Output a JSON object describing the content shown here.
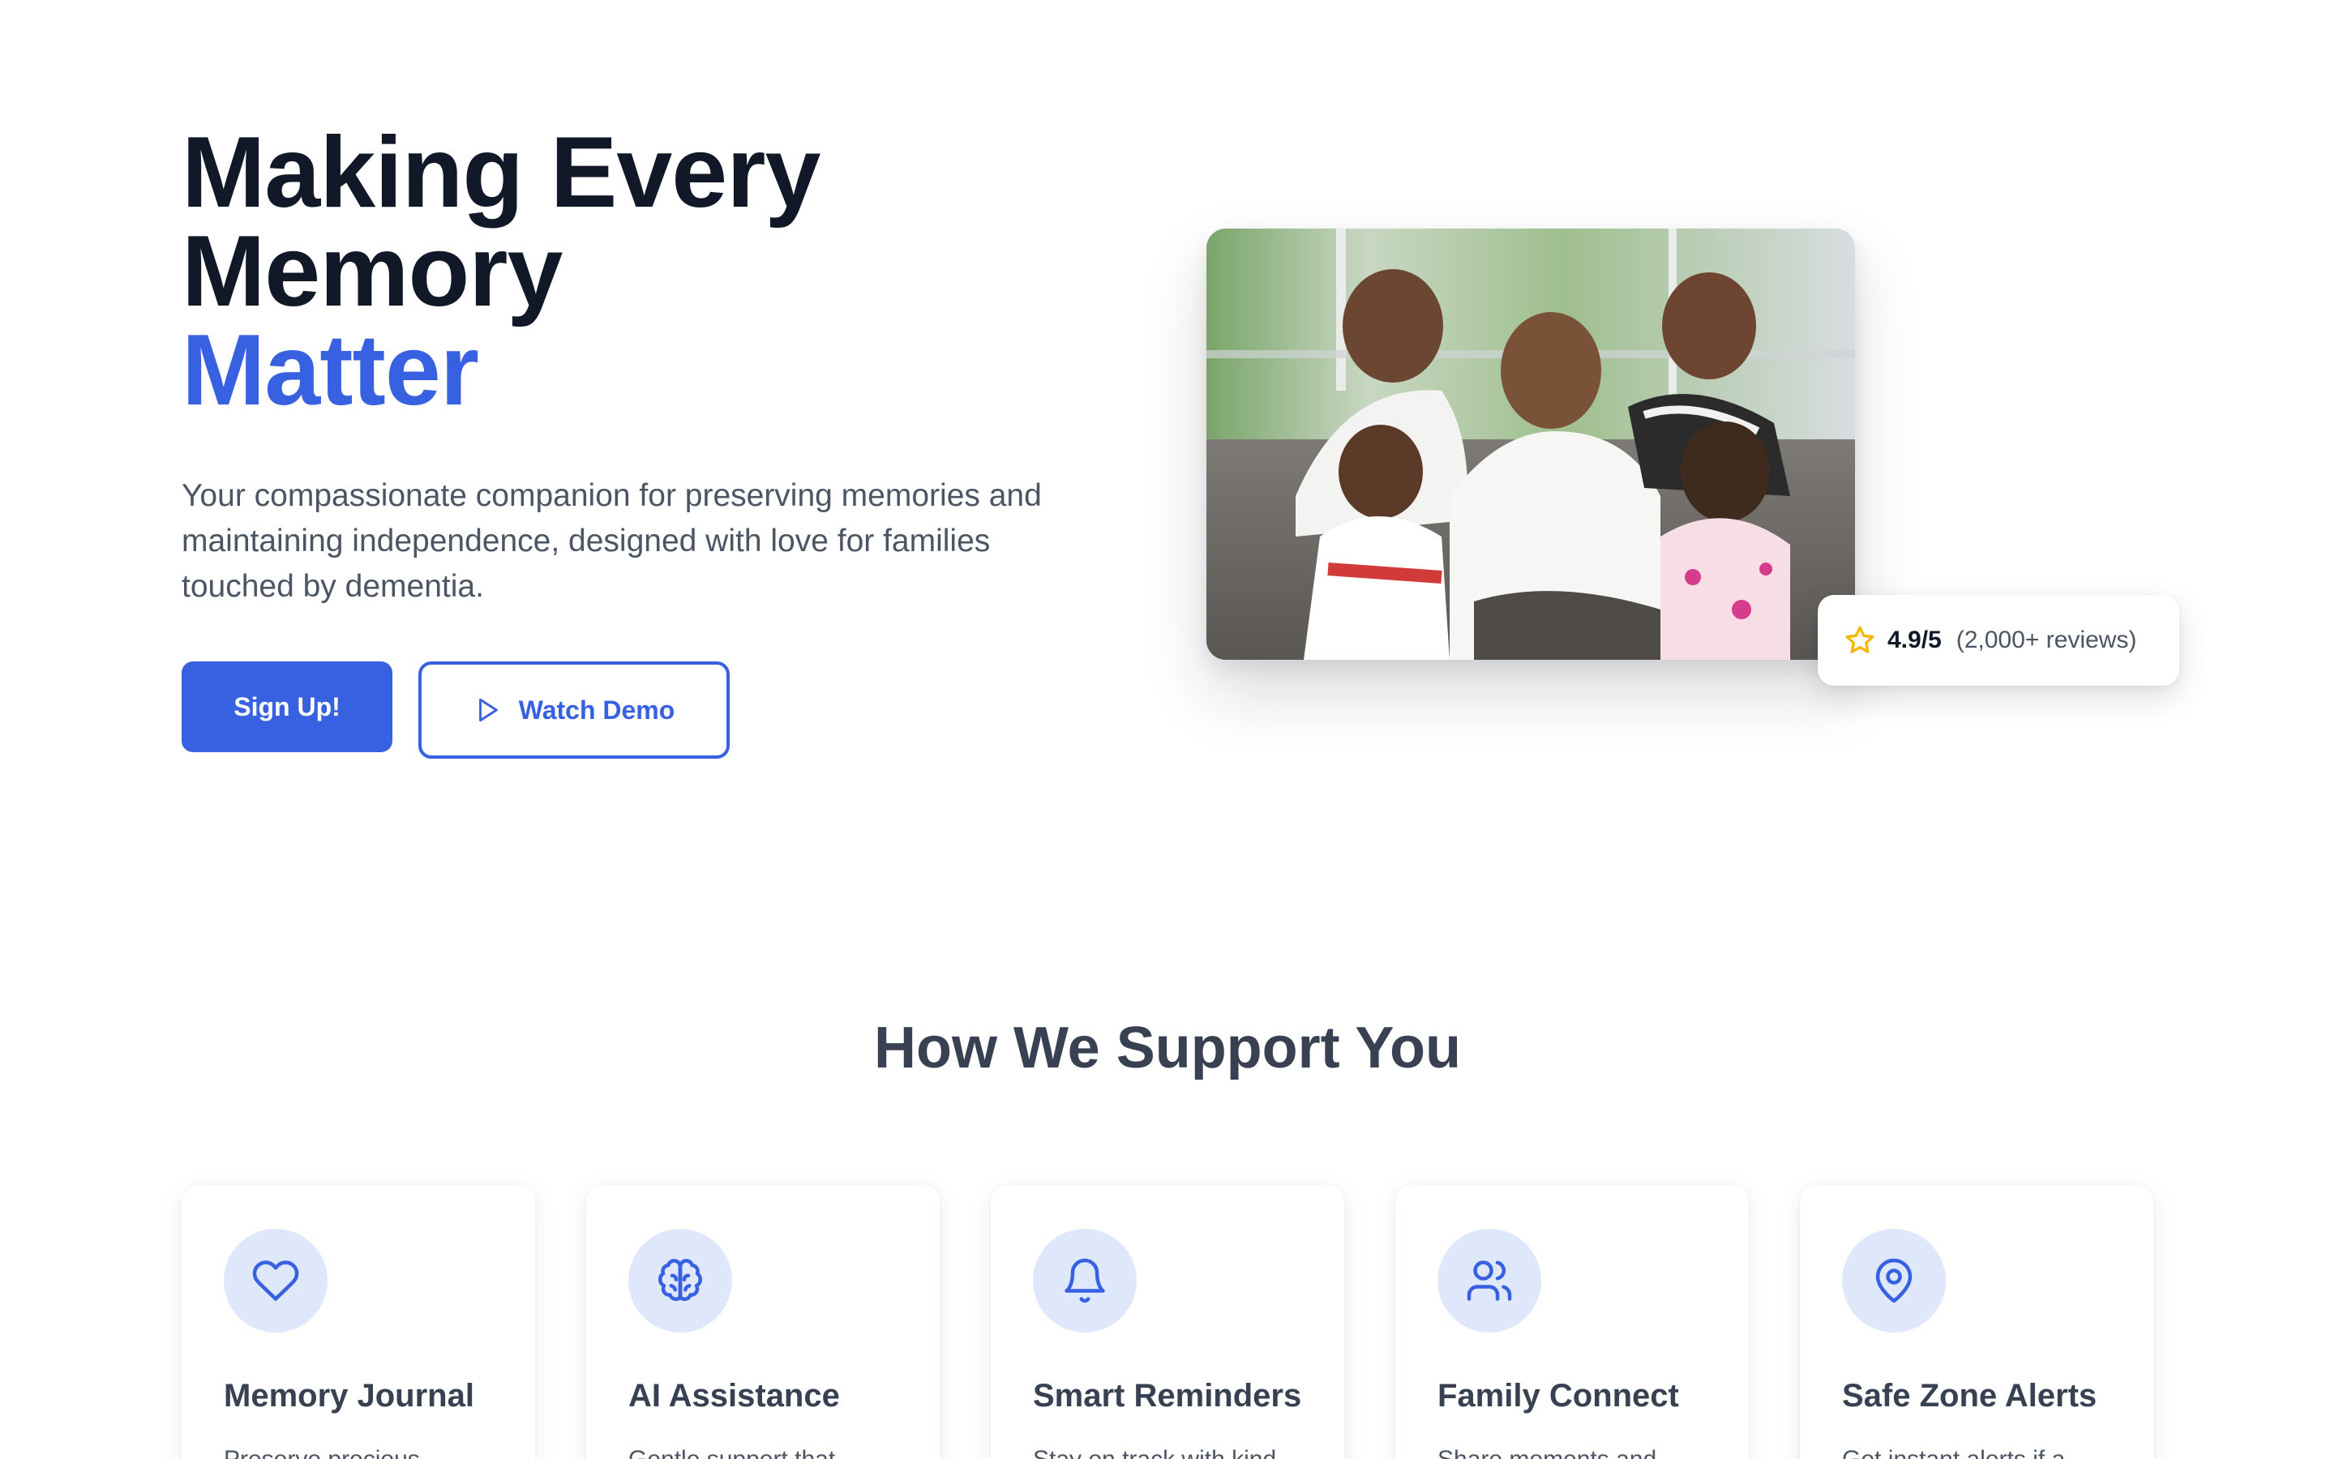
{
  "hero": {
    "title_line1": "Making Every",
    "title_line2": "Memory",
    "title_accent": "Matter",
    "subtitle": "Your compassionate companion for preserving memories and maintaining independence, designed with love for families touched by dementia.",
    "primary_button": "Sign Up!",
    "secondary_button": "Watch Demo",
    "secondary_button_icon": "play-icon",
    "photo_icon": "family-photo",
    "rating": {
      "icon": "star-icon",
      "score": "4.9/5",
      "count": "(2,000+ reviews)"
    }
  },
  "support": {
    "title": "How We Support You",
    "features": [
      {
        "icon": "heart-icon",
        "title": "Memory Journal",
        "description": "Preserve precious"
      },
      {
        "icon": "brain-icon",
        "title": "AI Assistance",
        "description": "Gentle support that"
      },
      {
        "icon": "bell-icon",
        "title": "Smart Reminders",
        "description": "Stay on track with kind"
      },
      {
        "icon": "users-icon",
        "title": "Family Connect",
        "description": "Share moments and"
      },
      {
        "icon": "map-pin-icon",
        "title": "Safe Zone Alerts",
        "description": "Get instant alerts if a"
      }
    ]
  },
  "colors": {
    "accent": "#3761e0",
    "heading": "#111827",
    "section_heading": "#374151",
    "body_text": "#4b5563",
    "icon_bg": "#dfe8fb",
    "star": "#f5b800"
  }
}
